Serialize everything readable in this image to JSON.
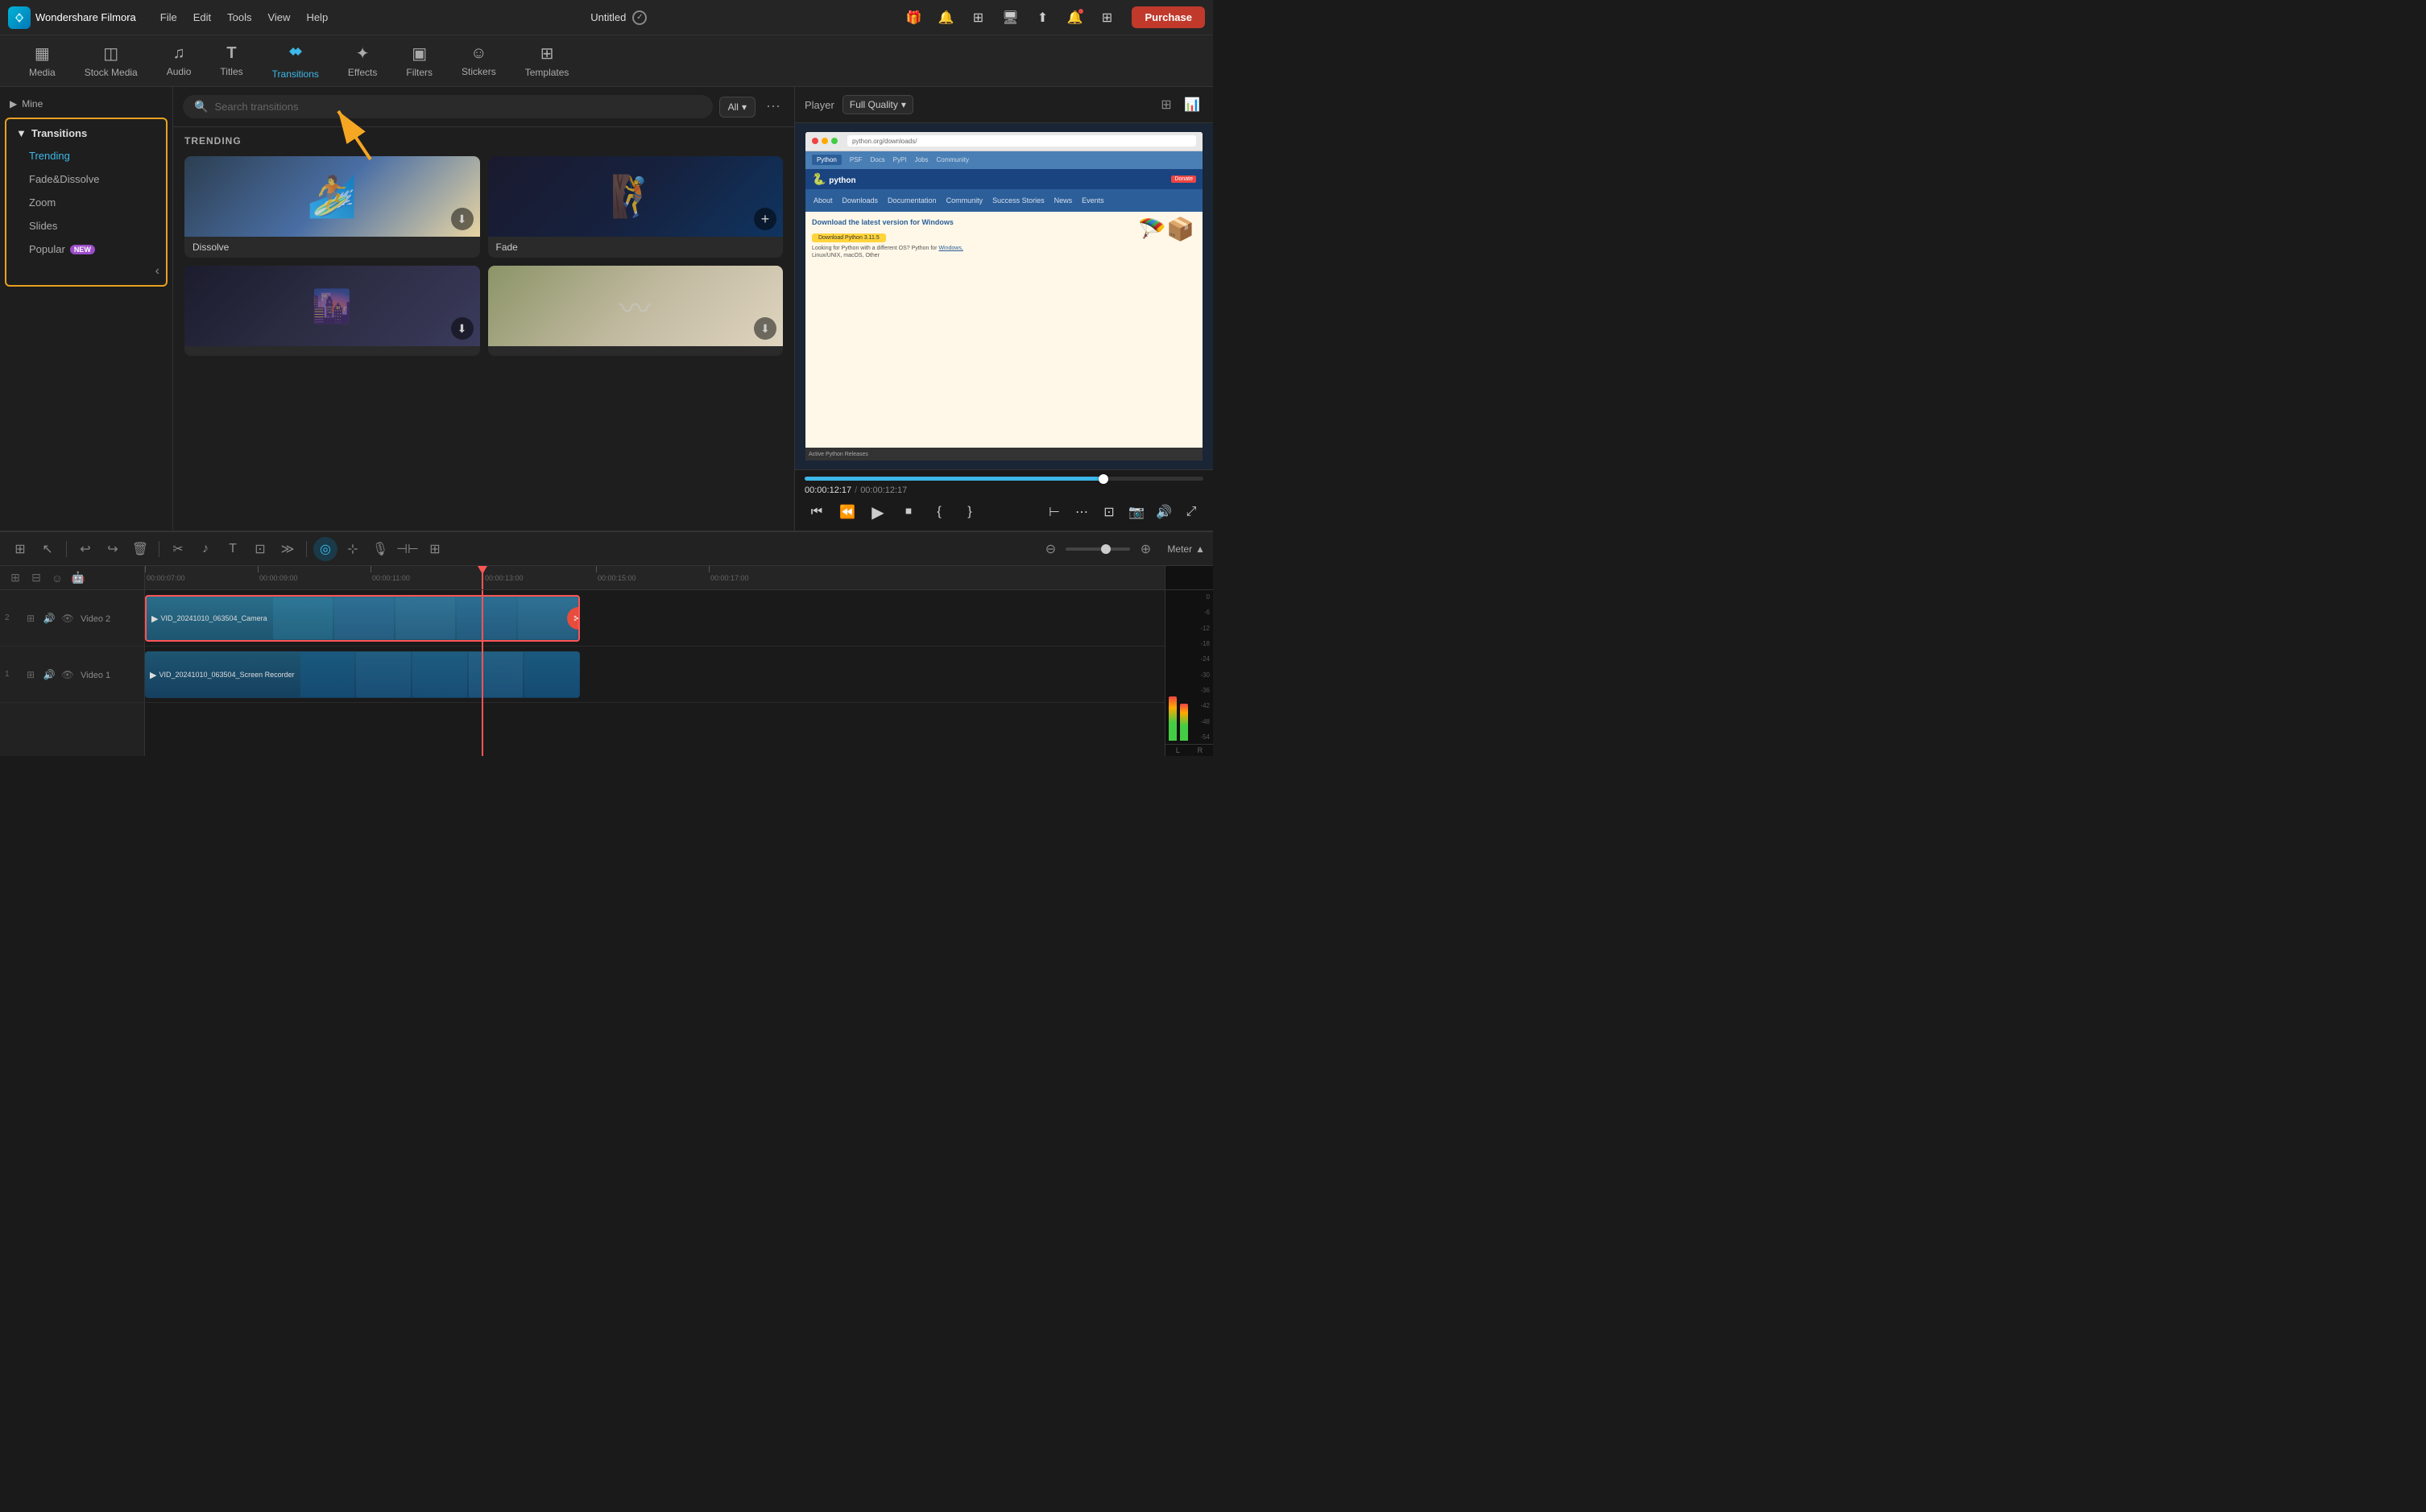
{
  "app": {
    "logo": "F",
    "name": "Wondershare Filmora",
    "title": "Untitled"
  },
  "menu": {
    "items": [
      "File",
      "Edit",
      "Tools",
      "View",
      "Help"
    ]
  },
  "topbar": {
    "icons": [
      "gift",
      "paper-plane",
      "grid",
      "monitor",
      "upload",
      "bell",
      "grid-2",
      "purchase"
    ],
    "purchase_label": "Purchase"
  },
  "nav": {
    "tabs": [
      {
        "id": "media",
        "label": "Media",
        "icon": "▦"
      },
      {
        "id": "stock-media",
        "label": "Stock Media",
        "icon": "◫"
      },
      {
        "id": "audio",
        "label": "Audio",
        "icon": "♫"
      },
      {
        "id": "titles",
        "label": "Titles",
        "icon": "T"
      },
      {
        "id": "transitions",
        "label": "Transitions",
        "icon": "↔",
        "active": true
      },
      {
        "id": "effects",
        "label": "Effects",
        "icon": "✦"
      },
      {
        "id": "filters",
        "label": "Filters",
        "icon": "▣"
      },
      {
        "id": "stickers",
        "label": "Stickers",
        "icon": "☺"
      },
      {
        "id": "templates",
        "label": "Templates",
        "icon": "⊞"
      }
    ]
  },
  "sidebar": {
    "mine_label": "Mine",
    "category": "Transitions",
    "items": [
      {
        "id": "trending",
        "label": "Trending",
        "active": true
      },
      {
        "id": "fade-dissolve",
        "label": "Fade&Dissolve"
      },
      {
        "id": "zoom",
        "label": "Zoom"
      },
      {
        "id": "slides",
        "label": "Slides"
      },
      {
        "id": "popular",
        "label": "Popular",
        "badge": "NEW"
      }
    ]
  },
  "search": {
    "placeholder": "Search transitions",
    "filter": "All"
  },
  "trending": {
    "label": "TRENDING",
    "cards": [
      {
        "id": "dissolve",
        "label": "Dissolve",
        "type": "dissolve",
        "icon": "download"
      },
      {
        "id": "fade",
        "label": "Fade",
        "type": "fade",
        "icon": "add"
      },
      {
        "id": "card3",
        "label": "",
        "type": "c3",
        "icon": "download"
      },
      {
        "id": "card4",
        "label": "",
        "type": "c4",
        "icon": "download"
      }
    ]
  },
  "player": {
    "label": "Player",
    "quality": "Full Quality",
    "time_current": "00:00:12:17",
    "time_total": "00:00:12:17",
    "preview": {
      "browser_bar_color": "#e8e8e8",
      "site": "python.org",
      "headline": "Download the latest version for Windows",
      "download_btn": "Download Python 3.11.5",
      "donate_label": "Donate",
      "nav_items": [
        "About",
        "Downloads",
        "Documentation",
        "Community",
        "Success Stories",
        "News",
        "Events"
      ]
    }
  },
  "timeline": {
    "tracks": [
      {
        "id": "video2",
        "num": "2",
        "label": "Video 2",
        "clip_label": "VID_20241010_063504_Camera",
        "clip_color": "#2a6e8a"
      },
      {
        "id": "video1",
        "num": "1",
        "label": "Video 1",
        "clip_label": "VID_20241010_063504_Screen Recorder",
        "clip_color": "#1e5570"
      }
    ],
    "ruler_marks": [
      "00:00:07:00",
      "00:00:09:00",
      "00:00:11:00",
      "00:00:13:00",
      "00:00:15:00",
      "00:00:17:00"
    ],
    "playhead_pos": "00:00:13:00",
    "meter_label": "Meter",
    "db_marks": [
      "0",
      "-6",
      "-12",
      "-18",
      "-24",
      "-30",
      "-36",
      "-42",
      "-48",
      "-54"
    ],
    "lr_labels": [
      "L",
      "R"
    ]
  },
  "toolbar": {
    "buttons": [
      "undo",
      "redo",
      "delete",
      "cut",
      "audio-snap",
      "title",
      "crop",
      "more",
      "ripple",
      "speed",
      "record",
      "split-audio",
      "add-to-timeline",
      "ai-tools"
    ]
  }
}
